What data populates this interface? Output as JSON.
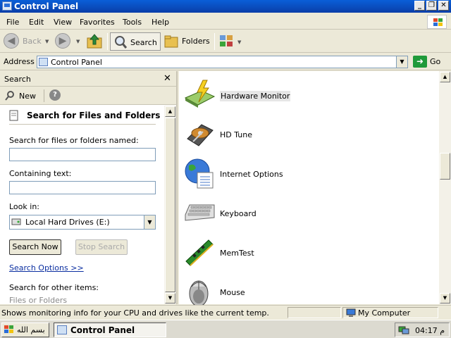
{
  "window": {
    "title": "Control Panel"
  },
  "menubar": {
    "items": [
      "File",
      "Edit",
      "View",
      "Favorites",
      "Tools",
      "Help"
    ]
  },
  "toolbar": {
    "back_label": "Back",
    "search_label": "Search",
    "folders_label": "Folders"
  },
  "address": {
    "label": "Address",
    "value": "Control Panel",
    "go_label": "Go"
  },
  "search_pane": {
    "header": "Search",
    "new_label": "New",
    "title": "Search for Files and Folders",
    "named_label": "Search for files or folders named:",
    "named_value": "",
    "containing_label": "Containing text:",
    "containing_value": "",
    "lookin_label": "Look in:",
    "lookin_value": "Local Hard Drives (E:)",
    "search_now": "Search Now",
    "stop_search": "Stop Search",
    "options_link": "Search Options >>",
    "other_items_label": "Search for other items:",
    "other_items_first": "Files or Folders"
  },
  "items": [
    {
      "label": "Hardware Monitor",
      "icon": "hardware-monitor-icon",
      "selected": true
    },
    {
      "label": "HD Tune",
      "icon": "hd-tune-icon"
    },
    {
      "label": "Internet Options",
      "icon": "internet-options-icon"
    },
    {
      "label": "Keyboard",
      "icon": "keyboard-icon"
    },
    {
      "label": "MemTest",
      "icon": "memtest-icon"
    },
    {
      "label": "Mouse",
      "icon": "mouse-icon"
    }
  ],
  "statusbar": {
    "text": "Shows monitoring info for your CPU and drives like the current temp.",
    "location": "My Computer"
  },
  "taskbar": {
    "start_label": "بسم الله",
    "task_label": "Control Panel",
    "clock": "04:17 م"
  },
  "colors": {
    "title_blue": "#0a4fc4",
    "selection": "#e6e6e6",
    "link": "#0a2ea0"
  }
}
